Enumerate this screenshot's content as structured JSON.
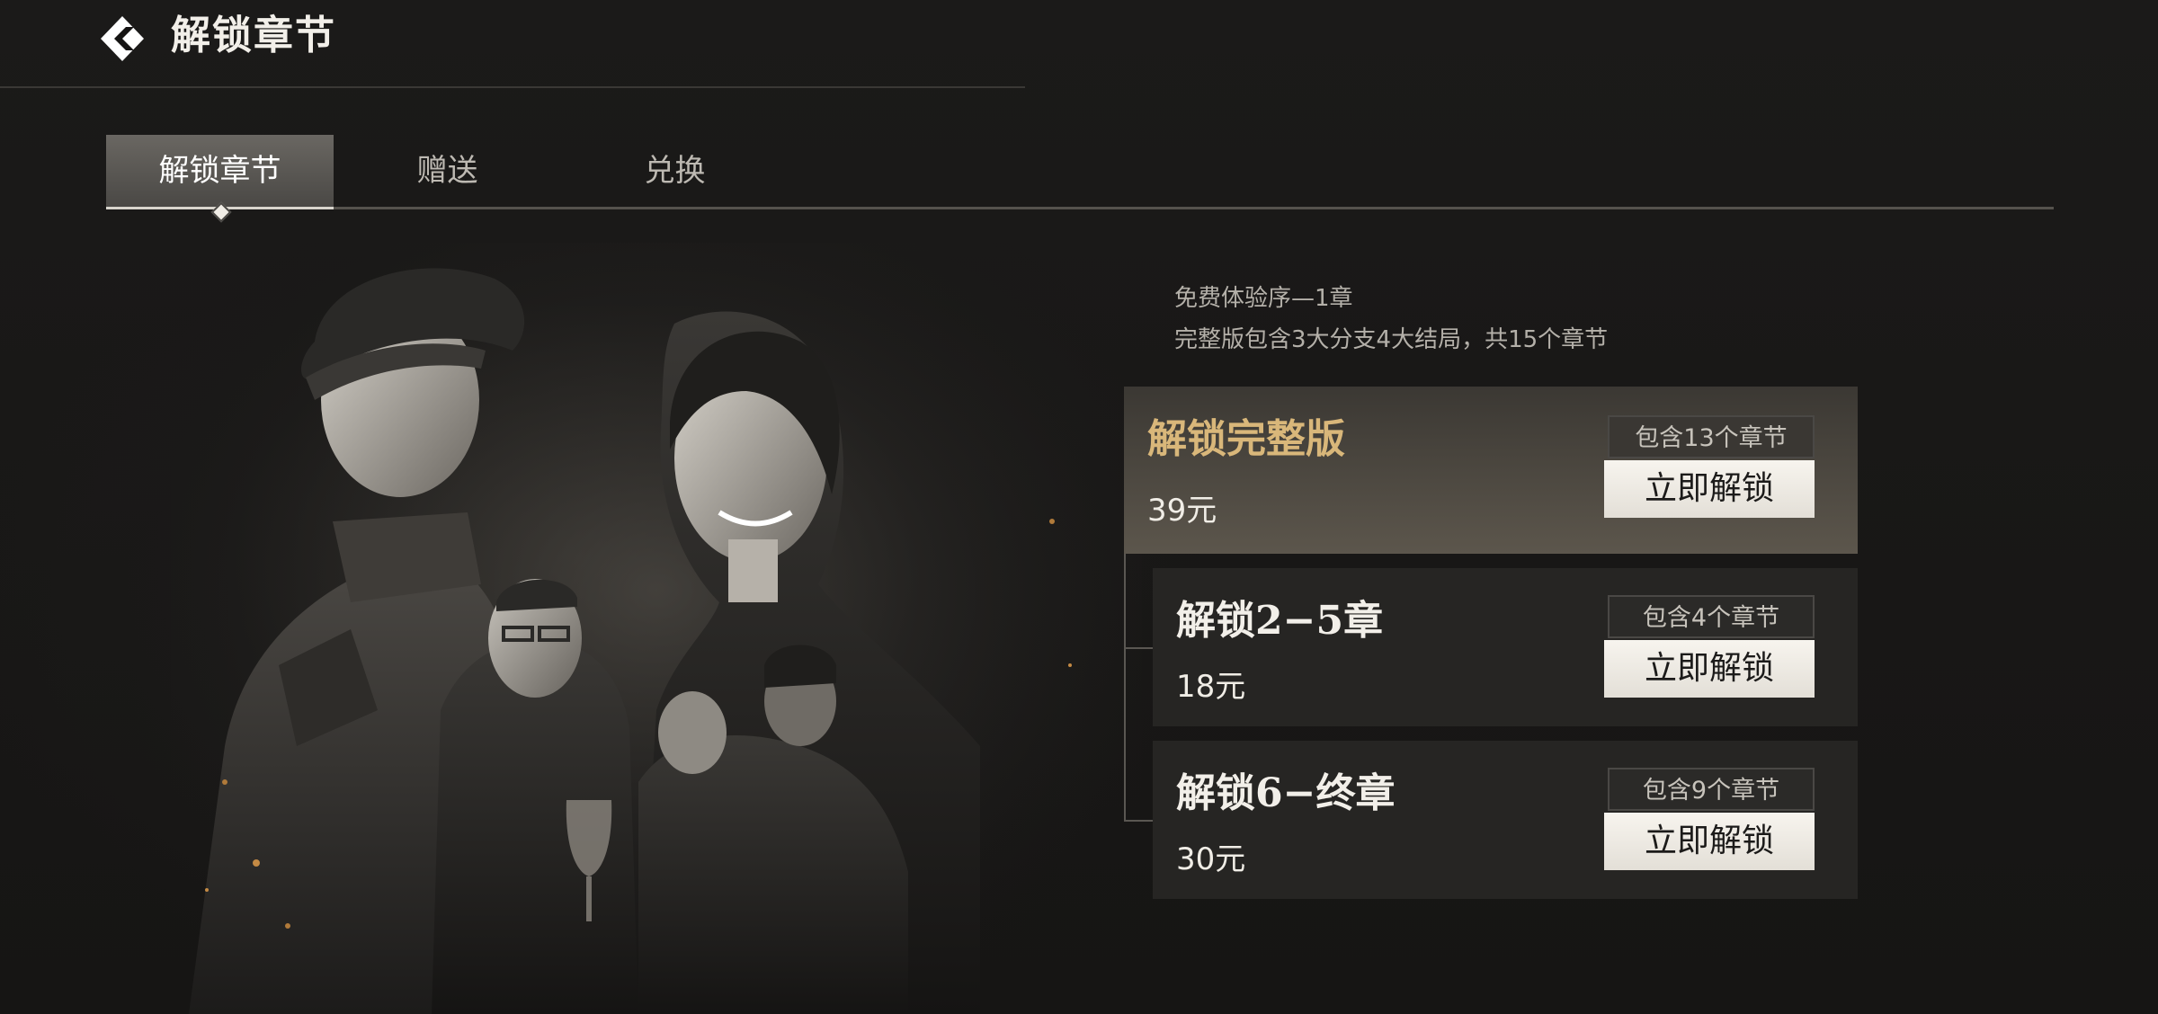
{
  "header": {
    "back_icon": "back-diamond-icon",
    "title": "解锁章节"
  },
  "tabs": [
    {
      "label": "解锁章节",
      "active": true
    },
    {
      "label": "赠送",
      "active": false
    },
    {
      "label": "兑换",
      "active": false
    }
  ],
  "info": {
    "line1": "免费体验序—1章",
    "line2": "完整版包含3大分支4大结局，共15个章节"
  },
  "options": [
    {
      "title": "解锁完整版",
      "price": "39元",
      "chapters": "包含13个章节",
      "button": "立即解锁",
      "featured": true
    },
    {
      "title": "解锁2−5章",
      "price": "18元",
      "chapters": "包含4个章节",
      "button": "立即解锁",
      "featured": false
    },
    {
      "title": "解锁6−终章",
      "price": "30元",
      "chapters": "包含9个章节",
      "button": "立即解锁",
      "featured": false
    }
  ],
  "hero": {
    "description_icon": "game-cast-artwork"
  },
  "colors": {
    "background": "#151413",
    "accent_gold": "#d9b77a",
    "button_bg": "#efebe4"
  }
}
